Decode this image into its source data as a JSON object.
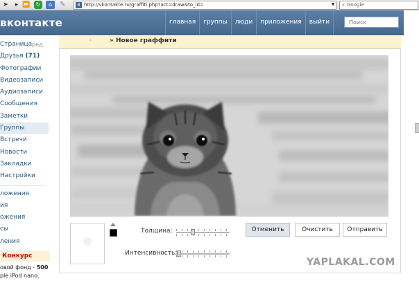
{
  "browser": {
    "url": "http://vkontakte.ru/graffiti.php?act=draw&to_id=",
    "search_placeholder": "Google",
    "favicon_text": "B"
  },
  "header": {
    "logo": "вконтакте",
    "nav": [
      "главная",
      "группы",
      "люди",
      "приложения",
      "выйти"
    ],
    "search_placeholder": "Поиск"
  },
  "sidebar": {
    "items": [
      {
        "label": "Страница",
        "edit": "ред."
      },
      {
        "label": "Друзья",
        "count": "(71)"
      },
      {
        "label": "Фотографии"
      },
      {
        "label": "Видеозаписи"
      },
      {
        "label": "Аудиозаписи"
      },
      {
        "label": "Сообщения"
      },
      {
        "label": "Заметки"
      },
      {
        "label": "Группы"
      },
      {
        "label": "Встречи"
      },
      {
        "label": "Новости"
      },
      {
        "label": "Закладки"
      },
      {
        "label": "Настройки"
      }
    ],
    "apps": [
      "ложения",
      "ия",
      "ожения",
      "сы",
      "ления"
    ],
    "promo": {
      "title": "Конкурс",
      "line1_prefix": "овой фонд - ",
      "line1_amount": "500",
      "line2": "ple iPod nano."
    }
  },
  "main": {
    "breadcrumb_prefix": "·",
    "breadcrumb": "» Новое граффити",
    "thickness_label": "Толщина:",
    "intensity_label": "Интенсивность:",
    "thickness_value": 0.3,
    "intensity_value": 0.02,
    "buttons": [
      "Отменить",
      "Очистить",
      "Отправить"
    ],
    "brush_color": "#000000"
  },
  "watermark": "YAPLAKAL.COM",
  "colors": {
    "header_bg": "#45688e",
    "link": "#2b587a",
    "crumb_bg": "#fcf3ce",
    "promo_title": "#b8120f"
  }
}
